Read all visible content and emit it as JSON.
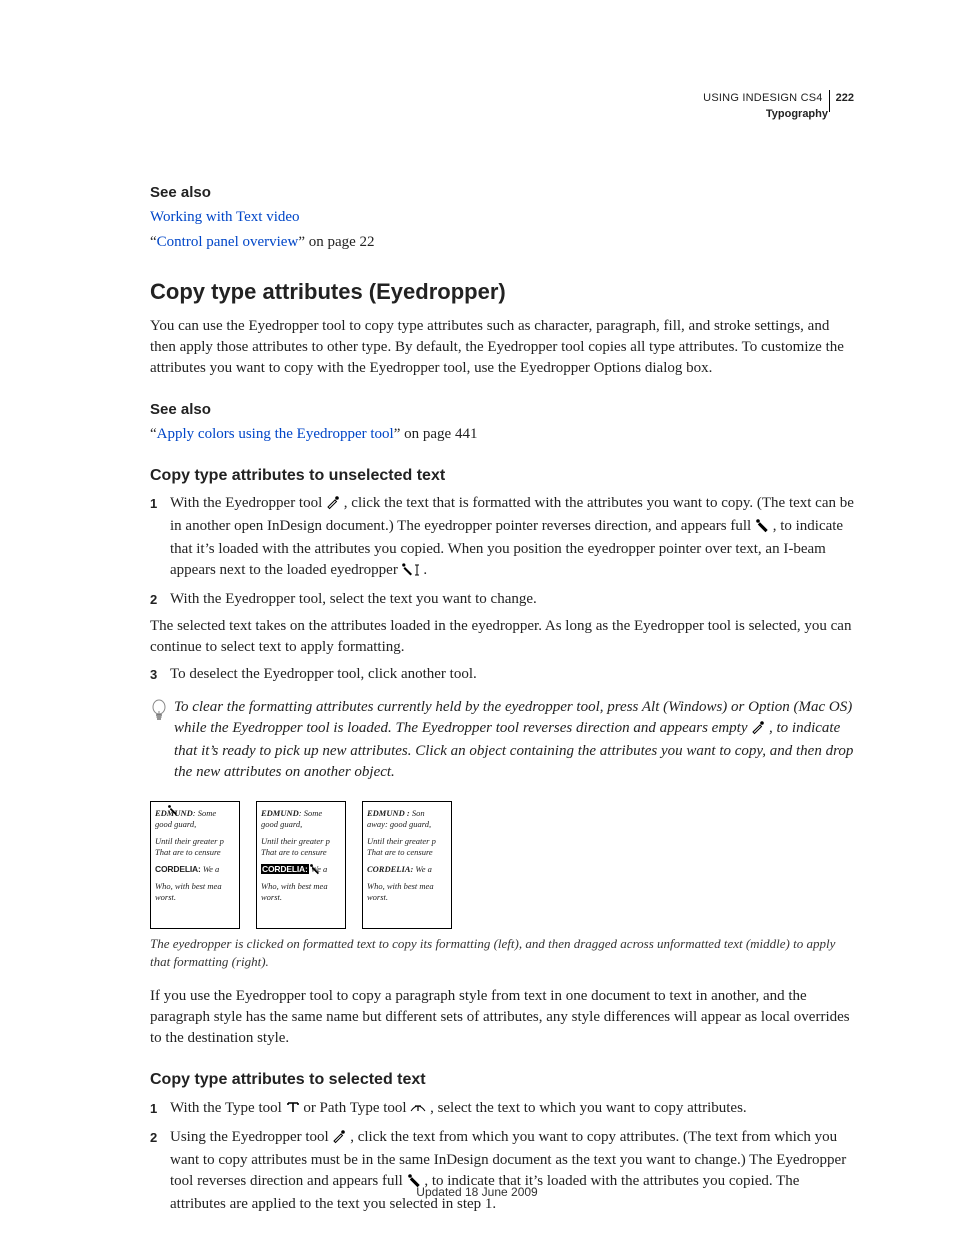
{
  "header": {
    "doc_title": "USING INDESIGN CS4",
    "page_number": "222",
    "section": "Typography"
  },
  "see_also_1": {
    "heading": "See also",
    "link1": "Working with Text video",
    "link2": "Control panel overview",
    "link2_suffix": "” on page 22"
  },
  "h_copy": "Copy type attributes (Eyedropper)",
  "intro": "You can use the Eyedropper tool to copy type attributes such as character, paragraph, fill, and stroke settings, and then apply those attributes to other type. By default, the Eyedropper tool copies all type attributes. To customize the attributes you want to copy with the Eyedropper tool, use the Eyedropper Options dialog box.",
  "see_also_2": {
    "heading": "See also",
    "link": "Apply colors using the Eyedropper tool",
    "suffix": "” on page 441"
  },
  "h_unsel": "Copy type attributes to unselected text",
  "steps_a": {
    "n1": "1",
    "s1a": "With the Eyedropper tool ",
    "s1b": ", click the text that is formatted with the attributes you want to copy. (The text can be in another open InDesign document.) The eyedropper pointer reverses direction, and appears full ",
    "s1c": ", to indicate that it’s loaded with the attributes you copied. When you position the eyedropper pointer over text, an I-beam appears next to the loaded eyedropper ",
    "s1d": ".",
    "n2": "2",
    "s2": "With the Eyedropper tool, select the text you want to change.",
    "mid": "The selected text takes on the attributes loaded in the eyedropper. As long as the Eyedropper tool is selected, you can continue to select text to apply formatting.",
    "n3": "3",
    "s3": "To deselect the Eyedropper tool, click another tool."
  },
  "tip": {
    "a": "To clear the formatting attributes currently held by the eyedropper tool, press Alt (Windows) or Option (Mac OS) while the Eyedropper tool is loaded. The Eyedropper tool reverses direction and appears empty ",
    "b": ", to indicate that it’s ready to pick up new attributes. Click an object containing the attributes you want to copy, and then drop the new attributes on another object."
  },
  "figure": {
    "edmund": "EDMUND",
    "edmund3": "EDMUND :",
    "some": "Some",
    "some_away": "Son",
    "good_guard": "good guard,",
    "good_guard3": "away: good guard,",
    "until": "Until their greater p",
    "that_are": "That are to censure",
    "cordelia": "CORDELIA:",
    "wea": "We a",
    "who": "Who, with best mea",
    "worst": "worst.",
    "caption": "The eyedropper is clicked on formatted text to copy its formatting (left), and then dragged across unformatted text (middle) to apply that formatting (right)."
  },
  "after_fig": "If you use the Eyedropper tool to copy a paragraph style from text in one document to text in another, and the paragraph style has the same name but different sets of attributes, any style differences will appear as local overrides to the destination style.",
  "h_sel": "Copy type attributes to selected text",
  "steps_b": {
    "n1": "1",
    "s1a": "With the Type tool ",
    "s1b": " or Path Type tool ",
    "s1c": ", select the text to which you want to copy attributes.",
    "n2": "2",
    "s2a": "Using the Eyedropper tool ",
    "s2b": ", click the text from which you want to copy attributes. (The text from which you want to copy attributes must be in the same InDesign document as the text you want to change.) The Eyedropper tool reverses direction and appears full ",
    "s2c": ", to indicate that it’s loaded with the attributes you copied. The attributes are applied to the text you selected in step 1."
  },
  "footer": "Updated 18 June 2009"
}
